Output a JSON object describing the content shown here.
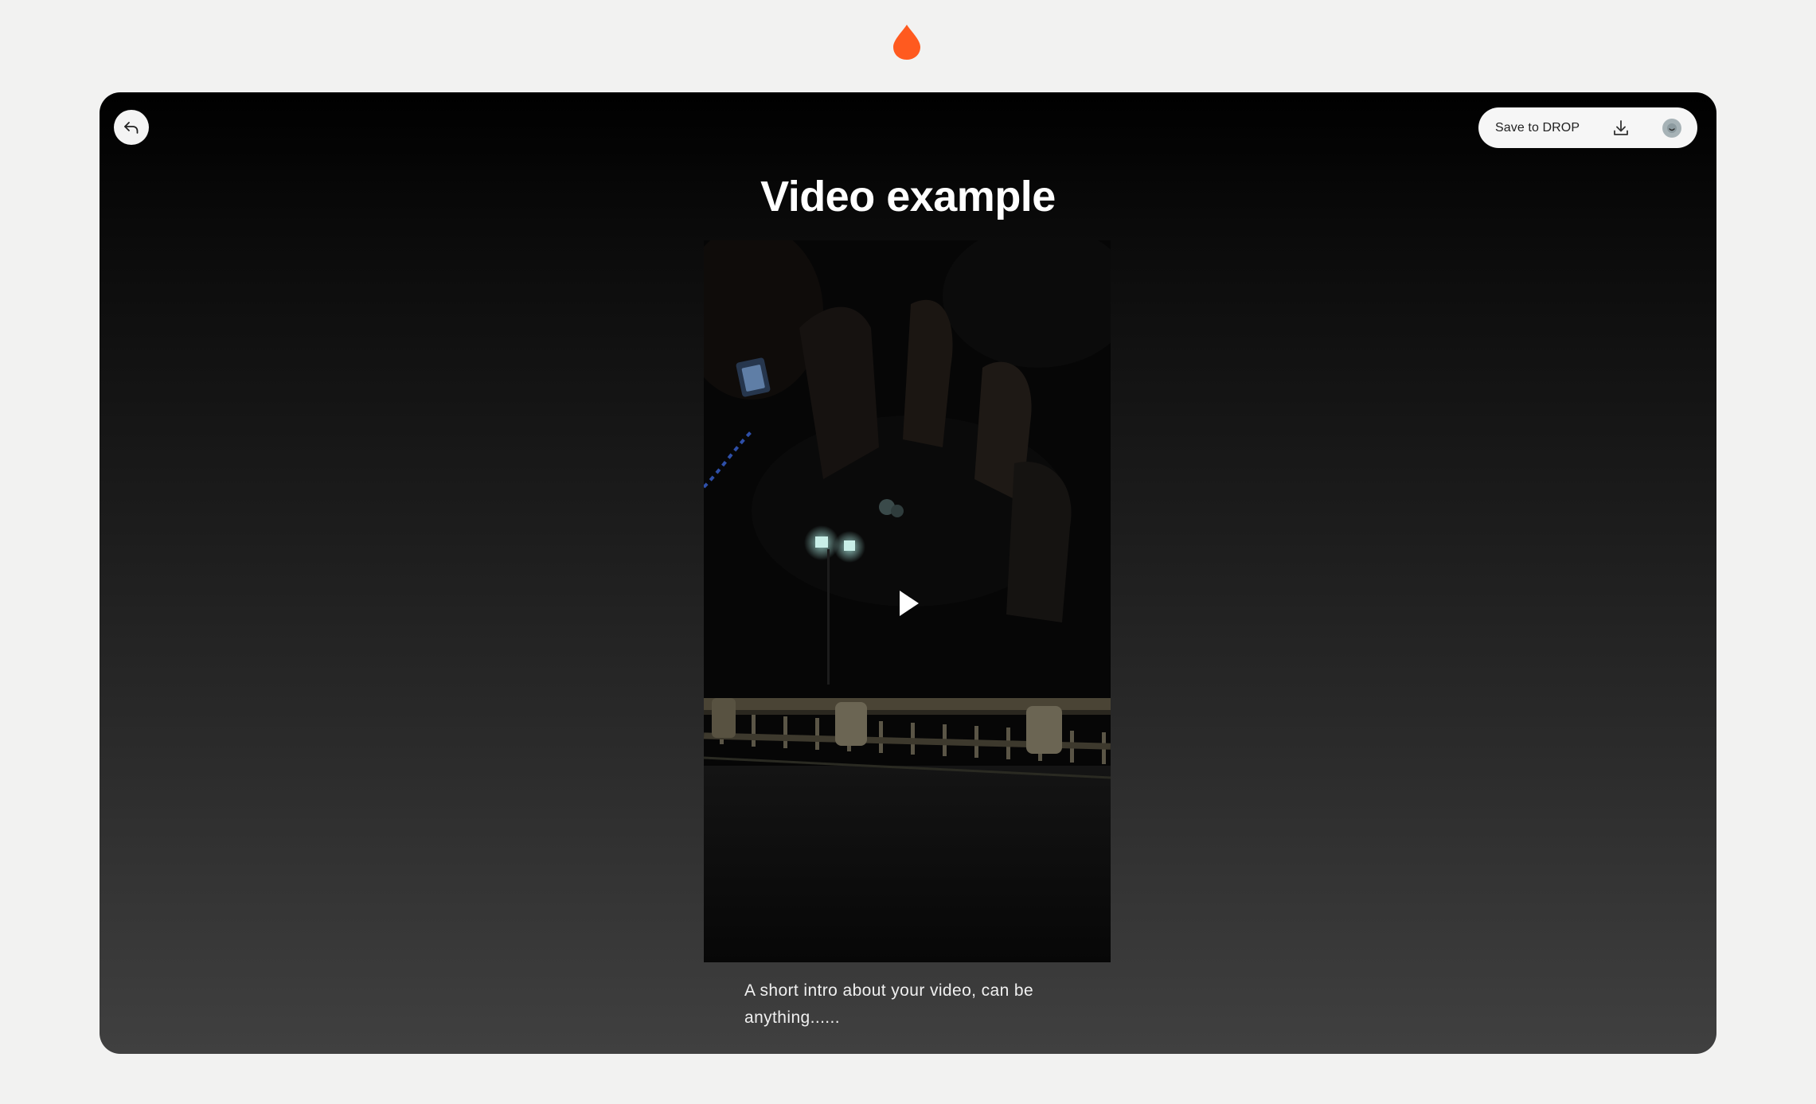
{
  "brand": {
    "logo_icon": "drop-icon",
    "accent_color": "#ff5a1f"
  },
  "toolbar": {
    "back_icon": "back-arrow-icon",
    "save_label": "Save to DROP",
    "download_icon": "download-icon",
    "avatar_icon": "avatar-icon"
  },
  "main": {
    "title": "Video example",
    "video": {
      "play_icon": "play-icon"
    },
    "caption": "A short intro about your video, can be anything......"
  }
}
